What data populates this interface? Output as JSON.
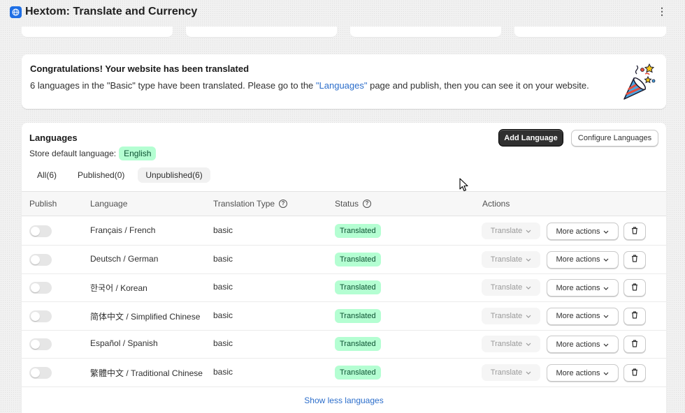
{
  "app": {
    "title": "Hextom: Translate and Currency",
    "icon": "globe-icon",
    "menu_icon": "kebab-menu-icon"
  },
  "colors": {
    "accent": "#1f6fe5",
    "link": "#2c6ecb",
    "success_badge_bg": "#b4fed2",
    "success_badge_text": "#0c5132",
    "primary_button": "#303030"
  },
  "banner": {
    "title": "Congratulations! Your website has been translated",
    "text_before": "6 languages in the \"Basic\" type have been translated. Please go to the ",
    "link": "\"Languages\"",
    "text_after": " page and publish, then you can see it on your website.",
    "illustration": "party-popper-icon"
  },
  "languages_card": {
    "title": "Languages",
    "default_label": "Store default language:",
    "default_value": "English",
    "add_button": "Add Language",
    "configure_button": "Configure Languages",
    "tabs": [
      {
        "label": "All(6)"
      },
      {
        "label": "Published(0)"
      },
      {
        "label": "Unpublished(6)"
      }
    ],
    "columns": {
      "publish": "Publish",
      "language": "Language",
      "translation_type": "Translation Type",
      "status": "Status",
      "actions": "Actions"
    },
    "rows": [
      {
        "language": "Français / French",
        "type": "basic",
        "status": "Translated",
        "translate": "Translate",
        "more": "More actions"
      },
      {
        "language": "Deutsch / German",
        "type": "basic",
        "status": "Translated",
        "translate": "Translate",
        "more": "More actions"
      },
      {
        "language": "한국어 / Korean",
        "type": "basic",
        "status": "Translated",
        "translate": "Translate",
        "more": "More actions"
      },
      {
        "language": "简体中文 / Simplified Chinese",
        "type": "basic",
        "status": "Translated",
        "translate": "Translate",
        "more": "More actions"
      },
      {
        "language": "Español / Spanish",
        "type": "basic",
        "status": "Translated",
        "translate": "Translate",
        "more": "More actions"
      },
      {
        "language": "繁體中文 / Traditional Chinese",
        "type": "basic",
        "status": "Translated",
        "translate": "Translate",
        "more": "More actions"
      }
    ],
    "show_less": "Show less languages"
  }
}
